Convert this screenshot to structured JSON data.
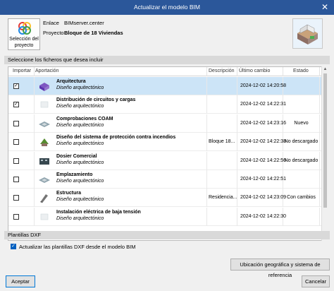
{
  "window": {
    "title": "Actualizar el modelo BIM",
    "close_glyph": "✕"
  },
  "project": {
    "select_button_label": "Selección del proyecto",
    "link_label": "Enlace",
    "link_value": "BIMserver.center",
    "project_label": "Proyecto",
    "project_value": "Bloque de 18 Viviendas"
  },
  "files_section": {
    "title": "Seleccione los ficheros que desea incluir",
    "columns": [
      "Importar",
      "Aportación",
      "Descripción",
      "Último cambio",
      "Estado"
    ],
    "rows": [
      {
        "checked": true,
        "selected": true,
        "name": "Arquitectura",
        "subtitle": "Diseño arquitectónico",
        "description": "",
        "date": "2024-12-02 14:20:58",
        "status": "",
        "thumb": "cube"
      },
      {
        "checked": true,
        "selected": false,
        "name": "Distribución de circuitos y cargas",
        "subtitle": "Diseño arquitectónico",
        "description": "",
        "date": "2024-12-02 14:22:31",
        "status": "",
        "thumb": "faint"
      },
      {
        "checked": false,
        "selected": false,
        "name": "Comprobaciones COAM",
        "subtitle": "Diseño arquitectónico",
        "description": "",
        "date": "2024-12-02 14:23:16",
        "status": "Nuevo",
        "thumb": "flat"
      },
      {
        "checked": false,
        "selected": false,
        "name": "Diseño del sistema de protección contra incendios",
        "subtitle": "Diseño arquitectónico",
        "description": "Bloque 18...",
        "date": "2024-12-02 14:22:38",
        "status": "No descargado",
        "thumb": "green"
      },
      {
        "checked": false,
        "selected": false,
        "name": "Dosier Comercial",
        "subtitle": "Diseño arquitectónico",
        "description": "",
        "date": "2024-12-02 14:22:56",
        "status": "No descargado",
        "thumb": "dark"
      },
      {
        "checked": false,
        "selected": false,
        "name": "Emplazamiento",
        "subtitle": "Diseño arquitectónico",
        "description": "",
        "date": "2024-12-02 14:22:51",
        "status": "",
        "thumb": "flat"
      },
      {
        "checked": false,
        "selected": false,
        "name": "Estructura",
        "subtitle": "Diseño arquitectónico",
        "description": "Residencia...",
        "date": "2024-12-02 14:23:09",
        "status": "Con cambios",
        "thumb": "grey"
      },
      {
        "checked": false,
        "selected": false,
        "name": "Instalación eléctrica de baja tensión",
        "subtitle": "Diseño arquitectónico",
        "description": "",
        "date": "2024-12-02 14:22:30",
        "status": "",
        "thumb": "faint"
      }
    ]
  },
  "dxf_section": {
    "title": "Plantillas DXF",
    "checkbox_label": "Actualizar las plantillas DXF desde el modelo BIM",
    "checked": true
  },
  "buttons": {
    "geo": "Ubicación geográfica y sistema de referencia",
    "accept": "Aceptar",
    "cancel": "Cancelar"
  },
  "icons": {
    "project": "bimserver-logo-icon",
    "preview": "building-preview-icon",
    "close": "close-icon",
    "check": "checkmark-icon"
  },
  "colors": {
    "titlebar": "#2b579a",
    "selected_row": "#cce4f7",
    "checkbox_accent": "#0060c0"
  }
}
